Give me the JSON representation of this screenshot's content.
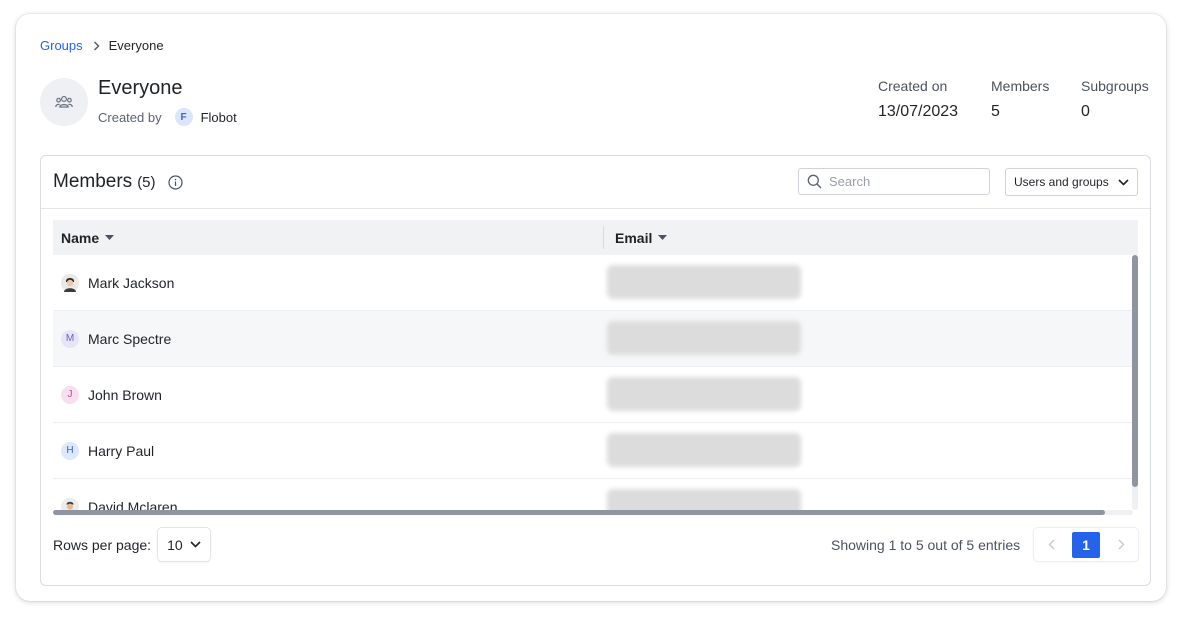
{
  "breadcrumb": {
    "parent": "Groups",
    "current": "Everyone"
  },
  "group": {
    "title": "Everyone",
    "created_by_label": "Created by",
    "creator_initial": "F",
    "creator_name": "Flobot"
  },
  "stats": [
    {
      "label": "Created on",
      "value": "13/07/2023"
    },
    {
      "label": "Members",
      "value": "5"
    },
    {
      "label": "Subgroups",
      "value": "0"
    }
  ],
  "members": {
    "title": "Members",
    "count": "(5)",
    "search_placeholder": "Search",
    "filter_label": "Users and groups",
    "columns": {
      "name": "Name",
      "email": "Email"
    },
    "rows": [
      {
        "name": "Mark Jackson",
        "avatar": "photo"
      },
      {
        "name": "Marc Spectre",
        "avatar": "M",
        "avatar_color": "#e6e4f7",
        "avatar_text_color": "#6b5fc9"
      },
      {
        "name": "John Brown",
        "avatar": "J",
        "avatar_color": "#f8dff0",
        "avatar_text_color": "#c2469a"
      },
      {
        "name": "Harry Paul",
        "avatar": "H",
        "avatar_color": "#dce8fb",
        "avatar_text_color": "#3b64d4"
      },
      {
        "name": "David Mclaren",
        "avatar": "photo"
      }
    ],
    "rows_per_page_label": "Rows per page:",
    "rows_per_page": "10",
    "showing": "Showing 1 to 5 out of 5 entries",
    "current_page": "1"
  },
  "colors": {
    "accent": "#2563eb"
  }
}
